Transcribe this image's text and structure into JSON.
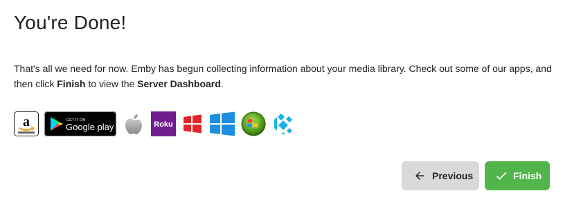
{
  "page": {
    "title": "You're Done!",
    "description": {
      "part1": "That's all we need for now. Emby has begun collecting information about your media library. Check out some of our apps, and then click ",
      "finish_word": "Finish",
      "part2": " to view the ",
      "dashboard_word": "Server Dashboard",
      "part3": "."
    }
  },
  "apps": [
    {
      "name": "Amazon",
      "icon": "amazon-icon"
    },
    {
      "name": "Google Play",
      "icon": "google-play-icon",
      "badge_top": "GET IT ON",
      "badge_text": "Google play"
    },
    {
      "name": "Apple",
      "icon": "apple-icon"
    },
    {
      "name": "Roku",
      "icon": "roku-icon",
      "label": "Roku"
    },
    {
      "name": "Windows 8",
      "icon": "windows-red-icon"
    },
    {
      "name": "Windows 10",
      "icon": "windows-blue-icon"
    },
    {
      "name": "Windows Media Center",
      "icon": "windows-media-center-icon"
    },
    {
      "name": "Kodi",
      "icon": "kodi-icon"
    }
  ],
  "buttons": {
    "previous": {
      "label": "Previous",
      "icon": "arrow-left-icon"
    },
    "finish": {
      "label": "Finish",
      "icon": "checkmark-icon"
    }
  },
  "colors": {
    "finish_bg": "#52b54b",
    "previous_bg": "#d9d9d9",
    "roku_purple": "#6f1d8e",
    "windows_red": "#e0262a",
    "windows_blue": "#1b8fe0",
    "kodi_blue": "#17b2e7"
  }
}
